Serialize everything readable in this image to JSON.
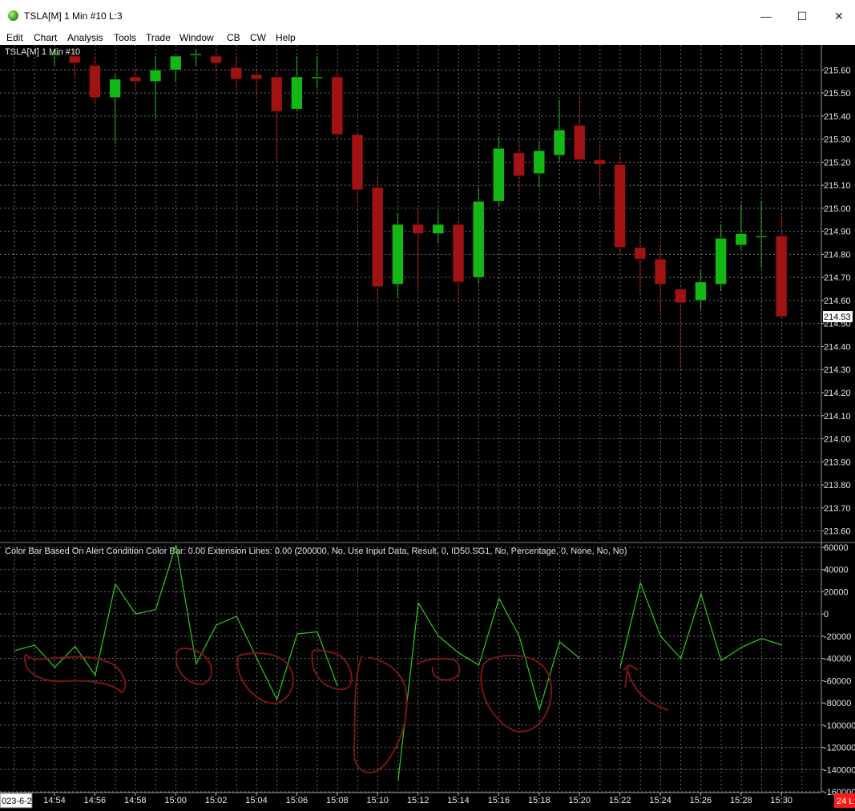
{
  "window": {
    "title": "TSLA[M]  1 Min  #10 L:3",
    "controls": {
      "minimize": "—",
      "maximize": "☐",
      "close": "✕"
    }
  },
  "menu": [
    "Edit",
    "Chart",
    "Analysis",
    "Tools",
    "Trade",
    "Window",
    "CB",
    "CW",
    "Help"
  ],
  "chart_data": [
    {
      "type": "candlestick",
      "label": "TSLA[M]  1 Min  #10",
      "y_ticks": [
        215.6,
        215.5,
        215.4,
        215.3,
        215.2,
        215.1,
        215.0,
        214.9,
        214.8,
        214.7,
        214.6,
        214.5,
        214.4,
        214.3,
        214.2,
        214.1,
        214.0,
        213.9,
        213.8,
        213.7,
        213.6
      ],
      "ylim": [
        213.55,
        215.66
      ],
      "last_price": "214.53",
      "colors": {
        "up": "#14b814",
        "down": "#a11212",
        "background": "#000000",
        "grid": "#6e6e6e"
      },
      "candles": [
        {
          "o": 215.67,
          "h": 215.69,
          "l": 215.62,
          "c": 215.67
        },
        {
          "o": 215.66,
          "h": 215.69,
          "l": 215.57,
          "c": 215.63
        },
        {
          "o": 215.62,
          "h": 215.66,
          "l": 215.45,
          "c": 215.48
        },
        {
          "o": 215.48,
          "h": 215.58,
          "l": 215.28,
          "c": 215.56
        },
        {
          "o": 215.57,
          "h": 215.6,
          "l": 215.52,
          "c": 215.55
        },
        {
          "o": 215.55,
          "h": 215.66,
          "l": 215.39,
          "c": 215.6
        },
        {
          "o": 215.6,
          "h": 215.66,
          "l": 215.55,
          "c": 215.66
        },
        {
          "o": 215.67,
          "h": 215.69,
          "l": 215.62,
          "c": 215.67
        },
        {
          "o": 215.66,
          "h": 215.69,
          "l": 215.58,
          "c": 215.63
        },
        {
          "o": 215.61,
          "h": 215.66,
          "l": 215.52,
          "c": 215.56
        },
        {
          "o": 215.58,
          "h": 215.61,
          "l": 215.48,
          "c": 215.56
        },
        {
          "o": 215.57,
          "h": 215.6,
          "l": 215.2,
          "c": 215.42
        },
        {
          "o": 215.43,
          "h": 215.66,
          "l": 215.42,
          "c": 215.57
        },
        {
          "o": 215.57,
          "h": 215.66,
          "l": 215.52,
          "c": 215.57
        },
        {
          "o": 215.57,
          "h": 215.6,
          "l": 215.3,
          "c": 215.32
        },
        {
          "o": 215.32,
          "h": 215.33,
          "l": 215.02,
          "c": 215.08
        },
        {
          "o": 215.09,
          "h": 215.14,
          "l": 214.61,
          "c": 214.66
        },
        {
          "o": 214.67,
          "h": 214.98,
          "l": 214.61,
          "c": 214.93
        },
        {
          "o": 214.93,
          "h": 215.0,
          "l": 214.64,
          "c": 214.89
        },
        {
          "o": 214.89,
          "h": 214.99,
          "l": 214.85,
          "c": 214.93
        },
        {
          "o": 214.93,
          "h": 214.95,
          "l": 214.6,
          "c": 214.68
        },
        {
          "o": 214.7,
          "h": 215.09,
          "l": 214.67,
          "c": 215.03
        },
        {
          "o": 215.03,
          "h": 215.31,
          "l": 215.01,
          "c": 215.26
        },
        {
          "o": 215.24,
          "h": 215.3,
          "l": 215.07,
          "c": 215.14
        },
        {
          "o": 215.15,
          "h": 215.29,
          "l": 215.09,
          "c": 215.25
        },
        {
          "o": 215.23,
          "h": 215.47,
          "l": 215.2,
          "c": 215.34
        },
        {
          "o": 215.36,
          "h": 215.48,
          "l": 215.2,
          "c": 215.21
        },
        {
          "o": 215.21,
          "h": 215.28,
          "l": 215.05,
          "c": 215.19
        },
        {
          "o": 215.19,
          "h": 215.24,
          "l": 214.8,
          "c": 214.83
        },
        {
          "o": 214.83,
          "h": 214.89,
          "l": 214.63,
          "c": 214.78
        },
        {
          "o": 214.78,
          "h": 214.84,
          "l": 214.55,
          "c": 214.67
        },
        {
          "o": 214.65,
          "h": 214.67,
          "l": 214.3,
          "c": 214.59
        },
        {
          "o": 214.6,
          "h": 214.73,
          "l": 214.56,
          "c": 214.68
        },
        {
          "o": 214.67,
          "h": 214.93,
          "l": 214.64,
          "c": 214.87
        },
        {
          "o": 214.84,
          "h": 215.02,
          "l": 214.82,
          "c": 214.89
        },
        {
          "o": 214.88,
          "h": 215.03,
          "l": 214.74,
          "c": 214.88
        },
        {
          "o": 214.88,
          "h": 214.97,
          "l": 214.53,
          "c": 214.53
        }
      ]
    },
    {
      "type": "line",
      "label": "Color Bar Based On Alert Condition  Color Bar: 0.00  Extension Lines: 0.00   (200000, No, Use Input Data, Result, 0, ID50.SG1, No, Percentage, 0, None, No, No)",
      "y_ticks": [
        60000,
        40000,
        20000,
        0,
        -20000,
        -40000,
        -60000,
        -80000,
        -100000,
        -120000,
        -140000,
        -160000
      ],
      "ylim": [
        -160000,
        60000
      ],
      "color": "#2ecc1a",
      "values": [
        -33000,
        -28000,
        -48000,
        -29000,
        -55000,
        27000,
        0,
        4000,
        62000,
        -45000,
        -10000,
        -2000,
        -40000,
        -77000,
        -18000,
        -16000,
        -65000,
        null,
        null,
        -150000,
        10000,
        -20000,
        -35000,
        -46000,
        14000,
        -20000,
        -86000,
        -25000,
        -40000,
        null,
        -48000,
        28000,
        -20000,
        -40000,
        18000,
        -42000,
        -30000,
        -22000,
        -28000
      ],
      "x_tick_labels": [
        "023-6-2",
        "14:54",
        "14:56",
        "14:58",
        "15:00",
        "15:02",
        "15:04",
        "15:06",
        "15:08",
        "15:10",
        "15:12",
        "15:14",
        "15:16",
        "15:18",
        "15:20",
        "15:22",
        "15:24",
        "15:26",
        "15:28",
        "15:30"
      ],
      "corner_badge": "24 L",
      "annotation_color": "#7a1515"
    }
  ]
}
